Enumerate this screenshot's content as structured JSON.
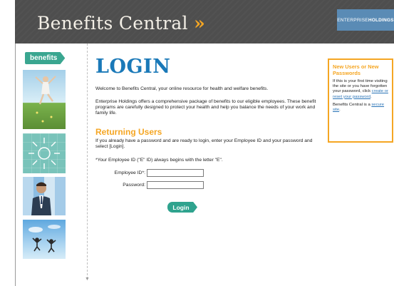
{
  "header": {
    "title": "Benefits Central",
    "title_chevron": "»",
    "logo_left": "ENTERPRISE",
    "logo_right": "HOLDINGS"
  },
  "sidebar": {
    "tab_label": "benefits"
  },
  "main": {
    "title": "LOGIN",
    "welcome": "Welcome to Benefits Central, your online resource for health and welfare benefits.",
    "enterprise": "Enterprise Holdings offers a comprehensive package of benefits to our eligible employees. These benefit programs are carefully designed to protect your health and help you balance the needs of your work and family life.",
    "returning_heading": "Returning Users",
    "already": "If you already have a password and are ready to login, enter your Employee ID and your password and select [Login].",
    "note": "*Your Employee ID (\"E\" ID) always begins with the letter \"E\".",
    "employee_id_label": "Employee ID*:",
    "employee_id_value": "",
    "password_label": "Password:",
    "password_value": "",
    "login_button": "Login"
  },
  "new_users": {
    "title": "New Users or New Passwords",
    "p1_prefix": "If this is your first time visiting the site or you have forgotten your password, click ",
    "p1_link": "create or reset your password",
    "p1_suffix": ".",
    "p2_prefix": "Benefits Central is a ",
    "p2_link": "secure site",
    "p2_suffix": "."
  },
  "colors": {
    "header_bg": "#4e4e4e",
    "accent_orange": "#f5a623",
    "login_blue": "#1a79b8",
    "button_teal": "#2fa38e"
  }
}
